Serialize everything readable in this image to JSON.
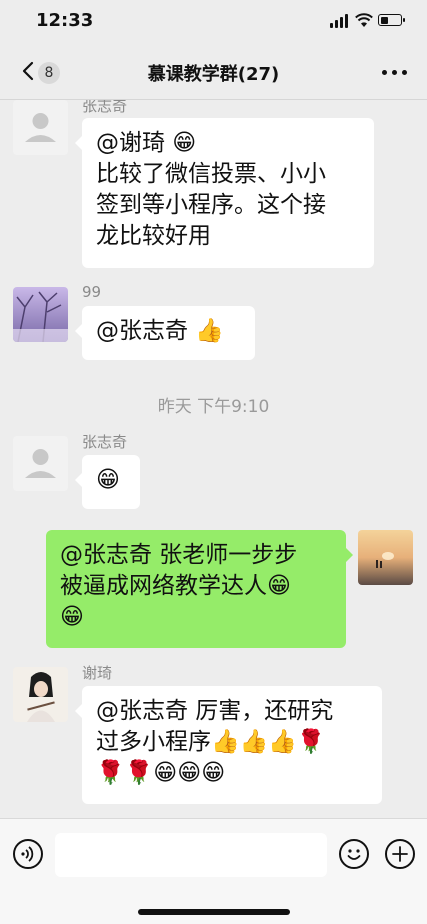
{
  "status_bar": {
    "time": "12:33",
    "battery_level": 0.4
  },
  "nav": {
    "back_count": "8",
    "title": "慕课教学群(27)"
  },
  "messages": [
    {
      "sender": "张志奇",
      "side": "left",
      "lines": [
        "@谢琦 😁",
        "比较了微信投票、小小",
        "签到等小程序。这个接",
        "龙比较好用"
      ]
    },
    {
      "sender": "99",
      "side": "left",
      "lines": [
        "@张志奇 👍"
      ]
    },
    {
      "timestamp": "昨天 下午9:10"
    },
    {
      "sender": "张志奇",
      "side": "left",
      "lines": [
        "😁"
      ]
    },
    {
      "side": "right",
      "lines": [
        "@张志奇 张老师一步步",
        "被逼成网络教学达人😁",
        "😁"
      ]
    },
    {
      "sender": "谢琦",
      "side": "left",
      "lines": [
        "@张志奇 厉害，还研究",
        "过多小程序👍👍👍🌹",
        "🌹🌹😁😁😁"
      ]
    }
  ],
  "input": {
    "placeholder": ""
  },
  "icons": {
    "voice": "voice-icon",
    "emoji": "emoji-icon",
    "plus": "plus-icon",
    "back": "chevron-left-icon",
    "more": "more-icon"
  },
  "colors": {
    "self_bubble": "#95ec69",
    "other_bubble": "#ffffff",
    "background": "#ededed"
  }
}
